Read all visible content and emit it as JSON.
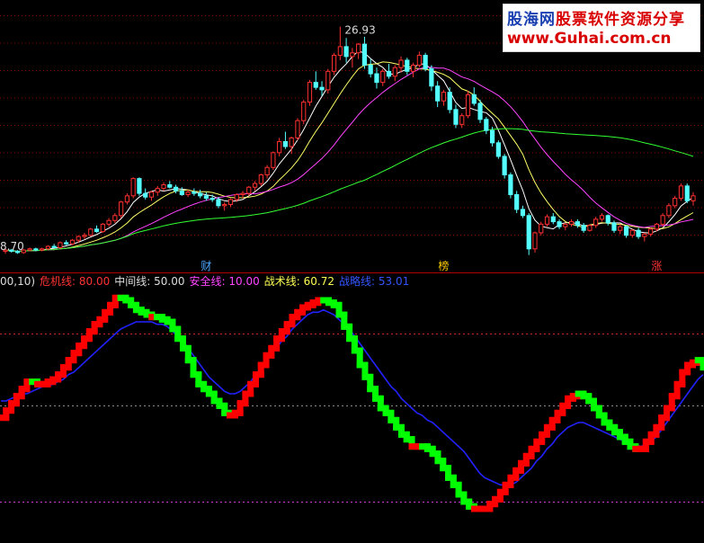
{
  "watermark": {
    "site_name": "股海网",
    "tagline": "股票软件资源分享",
    "url": "www.Guhai.com.cn"
  },
  "legend": {
    "prefix": "00,10)",
    "items": [
      {
        "label": "危机线:",
        "value": "80.00",
        "color": "#ff3333"
      },
      {
        "label": "中间线:",
        "value": "50.00",
        "color": "#dddddd"
      },
      {
        "label": "安全线:",
        "value": "10.00",
        "color": "#ff44ff"
      },
      {
        "label": "战术线:",
        "value": "60.72",
        "color": "#ffff55"
      },
      {
        "label": "战略线:",
        "value": "53.01",
        "color": "#3355ff"
      }
    ]
  },
  "chart_data": [
    {
      "type": "candlestick",
      "price_max_label": "26.93",
      "price_min_label": "8.70",
      "ylim": [
        7.5,
        28.5
      ],
      "event_markers": [
        {
          "label": "财",
          "index": 33,
          "color": "#4aa8ff"
        },
        {
          "label": "榜",
          "index": 72,
          "color": "#ffcc00"
        },
        {
          "label": "涨",
          "index": 107,
          "color": "#ff3333"
        }
      ],
      "candles": [
        [
          8.7,
          8.9,
          8.5,
          8.8
        ],
        [
          8.8,
          8.9,
          8.6,
          8.7
        ],
        [
          8.7,
          8.8,
          8.5,
          8.6
        ],
        [
          8.6,
          8.9,
          8.5,
          8.8
        ],
        [
          8.8,
          9.0,
          8.7,
          8.9
        ],
        [
          8.9,
          9.0,
          8.7,
          8.8
        ],
        [
          8.8,
          9.0,
          8.7,
          8.9
        ],
        [
          8.9,
          9.2,
          8.8,
          9.1
        ],
        [
          9.1,
          9.3,
          9.0,
          9.0
        ],
        [
          9.0,
          9.5,
          8.9,
          9.4
        ],
        [
          9.4,
          9.6,
          9.2,
          9.3
        ],
        [
          9.3,
          9.7,
          9.2,
          9.6
        ],
        [
          9.6,
          10.0,
          9.4,
          9.9
        ],
        [
          9.9,
          10.2,
          9.7,
          10.0
        ],
        [
          10.0,
          10.6,
          9.9,
          10.5
        ],
        [
          10.5,
          10.8,
          10.2,
          10.3
        ],
        [
          10.3,
          11.0,
          10.2,
          10.9
        ],
        [
          10.9,
          11.4,
          10.7,
          11.2
        ],
        [
          11.2,
          11.8,
          11.0,
          11.6
        ],
        [
          11.6,
          12.8,
          11.4,
          12.7
        ],
        [
          12.7,
          13.4,
          12.5,
          13.2
        ],
        [
          13.2,
          14.7,
          13.0,
          14.6
        ],
        [
          14.6,
          14.7,
          13.2,
          13.4
        ],
        [
          13.4,
          13.8,
          12.9,
          13.1
        ],
        [
          13.1,
          13.6,
          12.8,
          13.5
        ],
        [
          13.5,
          14.0,
          13.2,
          13.8
        ],
        [
          13.8,
          14.3,
          13.6,
          14.1
        ],
        [
          14.1,
          14.4,
          13.8,
          13.9
        ],
        [
          13.9,
          14.1,
          13.4,
          13.6
        ],
        [
          13.6,
          13.9,
          13.2,
          13.3
        ],
        [
          13.3,
          13.7,
          13.1,
          13.5
        ],
        [
          13.5,
          13.8,
          13.2,
          13.4
        ],
        [
          13.4,
          13.7,
          13.0,
          13.2
        ],
        [
          13.2,
          13.5,
          12.8,
          13.0
        ],
        [
          13.0,
          13.3,
          12.7,
          12.9
        ],
        [
          12.9,
          13.1,
          12.2,
          12.4
        ],
        [
          12.4,
          12.7,
          12.0,
          12.5
        ],
        [
          12.5,
          13.0,
          12.3,
          12.9
        ],
        [
          12.9,
          13.4,
          12.7,
          13.3
        ],
        [
          13.3,
          13.6,
          13.0,
          13.4
        ],
        [
          13.4,
          14.0,
          13.2,
          13.9
        ],
        [
          13.9,
          14.4,
          13.6,
          14.2
        ],
        [
          14.2,
          15.0,
          14.0,
          14.9
        ],
        [
          14.9,
          15.7,
          14.6,
          15.5
        ],
        [
          15.5,
          16.8,
          15.3,
          16.7
        ],
        [
          16.7,
          17.9,
          16.4,
          17.6
        ],
        [
          17.6,
          18.4,
          17.0,
          17.2
        ],
        [
          17.2,
          18.0,
          16.6,
          17.9
        ],
        [
          17.9,
          19.5,
          17.7,
          19.3
        ],
        [
          19.3,
          21.0,
          19.0,
          20.8
        ],
        [
          20.8,
          22.6,
          20.5,
          22.4
        ],
        [
          22.4,
          23.3,
          21.8,
          22.0
        ],
        [
          22.0,
          22.5,
          21.3,
          21.8
        ],
        [
          21.8,
          23.5,
          21.5,
          23.3
        ],
        [
          23.3,
          24.8,
          23.0,
          24.6
        ],
        [
          24.6,
          26.93,
          24.2,
          25.3
        ],
        [
          25.3,
          26.0,
          24.0,
          24.5
        ],
        [
          24.5,
          25.2,
          23.6,
          24.8
        ],
        [
          24.8,
          25.6,
          24.3,
          25.5
        ],
        [
          25.5,
          26.1,
          23.5,
          23.8
        ],
        [
          23.8,
          24.3,
          22.8,
          23.1
        ],
        [
          23.1,
          23.6,
          21.9,
          22.4
        ],
        [
          22.4,
          23.5,
          22.1,
          23.3
        ],
        [
          23.3,
          23.9,
          22.7,
          22.9
        ],
        [
          22.9,
          23.8,
          22.5,
          23.6
        ],
        [
          23.6,
          24.5,
          23.2,
          24.2
        ],
        [
          24.2,
          24.4,
          23.0,
          23.3
        ],
        [
          23.3,
          24.0,
          22.8,
          23.8
        ],
        [
          23.8,
          24.9,
          23.6,
          24.6
        ],
        [
          24.6,
          24.8,
          23.3,
          23.5
        ],
        [
          23.5,
          23.8,
          21.7,
          22.1
        ],
        [
          22.1,
          22.5,
          20.4,
          20.9
        ],
        [
          20.9,
          21.8,
          20.5,
          21.6
        ],
        [
          21.6,
          22.0,
          19.9,
          20.2
        ],
        [
          20.2,
          20.6,
          18.7,
          19.0
        ],
        [
          19.0,
          19.9,
          18.7,
          19.7
        ],
        [
          19.7,
          21.7,
          19.5,
          21.4
        ],
        [
          21.4,
          22.0,
          20.5,
          20.7
        ],
        [
          20.7,
          21.0,
          19.1,
          19.4
        ],
        [
          19.4,
          19.6,
          18.2,
          18.5
        ],
        [
          18.5,
          18.8,
          17.2,
          17.5
        ],
        [
          17.5,
          17.7,
          16.2,
          16.4
        ],
        [
          16.4,
          16.6,
          14.6,
          14.9
        ],
        [
          14.9,
          15.1,
          13.0,
          13.3
        ],
        [
          13.3,
          13.6,
          11.8,
          12.1
        ],
        [
          12.1,
          12.4,
          11.4,
          11.6
        ],
        [
          11.6,
          11.8,
          8.4,
          8.9
        ],
        [
          8.9,
          10.3,
          8.6,
          10.2
        ],
        [
          10.2,
          11.1,
          10.0,
          10.9
        ],
        [
          10.9,
          11.7,
          10.7,
          11.5
        ],
        [
          11.5,
          11.8,
          10.9,
          11.1
        ],
        [
          11.1,
          11.3,
          10.5,
          10.7
        ],
        [
          10.7,
          11.0,
          10.4,
          10.9
        ],
        [
          10.9,
          11.3,
          10.7,
          11.1
        ],
        [
          11.1,
          11.3,
          10.6,
          10.8
        ],
        [
          10.8,
          11.0,
          10.2,
          10.4
        ],
        [
          10.4,
          10.9,
          10.3,
          10.8
        ],
        [
          10.8,
          11.5,
          10.6,
          11.3
        ],
        [
          11.3,
          11.8,
          11.1,
          11.6
        ],
        [
          11.6,
          11.7,
          10.8,
          11.0
        ],
        [
          11.0,
          11.2,
          10.2,
          10.4
        ],
        [
          10.4,
          10.9,
          10.1,
          10.7
        ],
        [
          10.7,
          10.8,
          9.8,
          10.0
        ],
        [
          10.0,
          10.5,
          9.8,
          10.4
        ],
        [
          10.4,
          10.6,
          9.7,
          9.9
        ],
        [
          9.9,
          10.2,
          9.5,
          10.1
        ],
        [
          10.1,
          10.6,
          9.9,
          10.5
        ],
        [
          10.5,
          11.0,
          10.3,
          10.9
        ],
        [
          10.9,
          11.8,
          10.7,
          11.6
        ],
        [
          11.6,
          12.6,
          11.4,
          12.4
        ],
        [
          12.4,
          13.2,
          12.2,
          13.0
        ],
        [
          13.0,
          14.2,
          12.8,
          14.0
        ],
        [
          14.0,
          14.2,
          12.6,
          12.8
        ],
        [
          12.8,
          13.5,
          12.4,
          13.2
        ]
      ],
      "moving_averages": [
        {
          "name": "MA5",
          "color": "#ffffff"
        },
        {
          "name": "MA10",
          "color": "#ffff66"
        },
        {
          "name": "MA20",
          "color": "#ff44ff"
        },
        {
          "name": "MA60",
          "color": "#33ff33"
        }
      ]
    },
    {
      "type": "line",
      "ylim": [
        -5,
        100
      ],
      "reference_lines": [
        {
          "name": "危机线",
          "value": 80.0,
          "color": "#ff3333"
        },
        {
          "name": "中间线",
          "value": 50.0,
          "color": "#aaaaaa"
        },
        {
          "name": "安全线",
          "value": 10.0,
          "color": "#ff44ff"
        }
      ],
      "series": [
        {
          "name": "战术线",
          "rising_color": "#ff0000",
          "falling_color": "#00ff00",
          "values": [
            45,
            48,
            51,
            54,
            57,
            60,
            60,
            59,
            59,
            60,
            61,
            63,
            66,
            69,
            72,
            75,
            78,
            81,
            84,
            86,
            89,
            92,
            95,
            95,
            94,
            92,
            90,
            89,
            88,
            87,
            87,
            86,
            85,
            82,
            78,
            74,
            69,
            63,
            59,
            57,
            55,
            52,
            50,
            47,
            46,
            47,
            51,
            55,
            59,
            63,
            67,
            71,
            74,
            78,
            81,
            84,
            87,
            89,
            91,
            92,
            93,
            94,
            94,
            93,
            92,
            88,
            83,
            78,
            73,
            67,
            62,
            57,
            53,
            49,
            47,
            44,
            41,
            38,
            36,
            33,
            33,
            33,
            32,
            30,
            27,
            24,
            20,
            17,
            13,
            10,
            8,
            7,
            7,
            7,
            9,
            11,
            14,
            17,
            20,
            23,
            26,
            29,
            32,
            35,
            38,
            41,
            44,
            47,
            50,
            53,
            54,
            55,
            54,
            52,
            49,
            46,
            43,
            41,
            39,
            37,
            35,
            33,
            32,
            32,
            35,
            38,
            41,
            45,
            49,
            54,
            59,
            64,
            67,
            68,
            69,
            66
          ]
        },
        {
          "name": "战略线",
          "color": "#2222ff",
          "values": [
            52,
            52,
            53,
            54,
            55,
            55,
            56,
            57,
            58,
            58,
            59,
            60,
            61,
            63,
            64,
            66,
            68,
            70,
            72,
            74,
            76,
            78,
            80,
            82,
            83,
            84,
            85,
            85,
            85,
            85,
            84,
            84,
            83,
            81,
            79,
            77,
            74,
            71,
            68,
            65,
            62,
            60,
            58,
            56,
            55,
            55,
            56,
            58,
            60,
            63,
            66,
            69,
            72,
            74,
            77,
            79,
            82,
            84,
            86,
            88,
            89,
            89,
            90,
            89,
            88,
            86,
            84,
            82,
            79,
            76,
            73,
            70,
            67,
            64,
            61,
            58,
            56,
            53,
            51,
            49,
            47,
            46,
            44,
            43,
            41,
            39,
            37,
            35,
            33,
            31,
            28,
            25,
            22,
            20,
            19,
            18,
            17,
            17,
            17,
            18,
            20,
            22,
            24,
            27,
            29,
            32,
            34,
            37,
            39,
            41,
            42,
            43,
            43,
            42,
            41,
            40,
            39,
            38,
            37,
            36,
            35,
            34,
            34,
            33,
            34,
            35,
            37,
            40,
            43,
            46,
            49,
            52,
            55,
            58,
            61,
            63
          ]
        }
      ]
    }
  ]
}
